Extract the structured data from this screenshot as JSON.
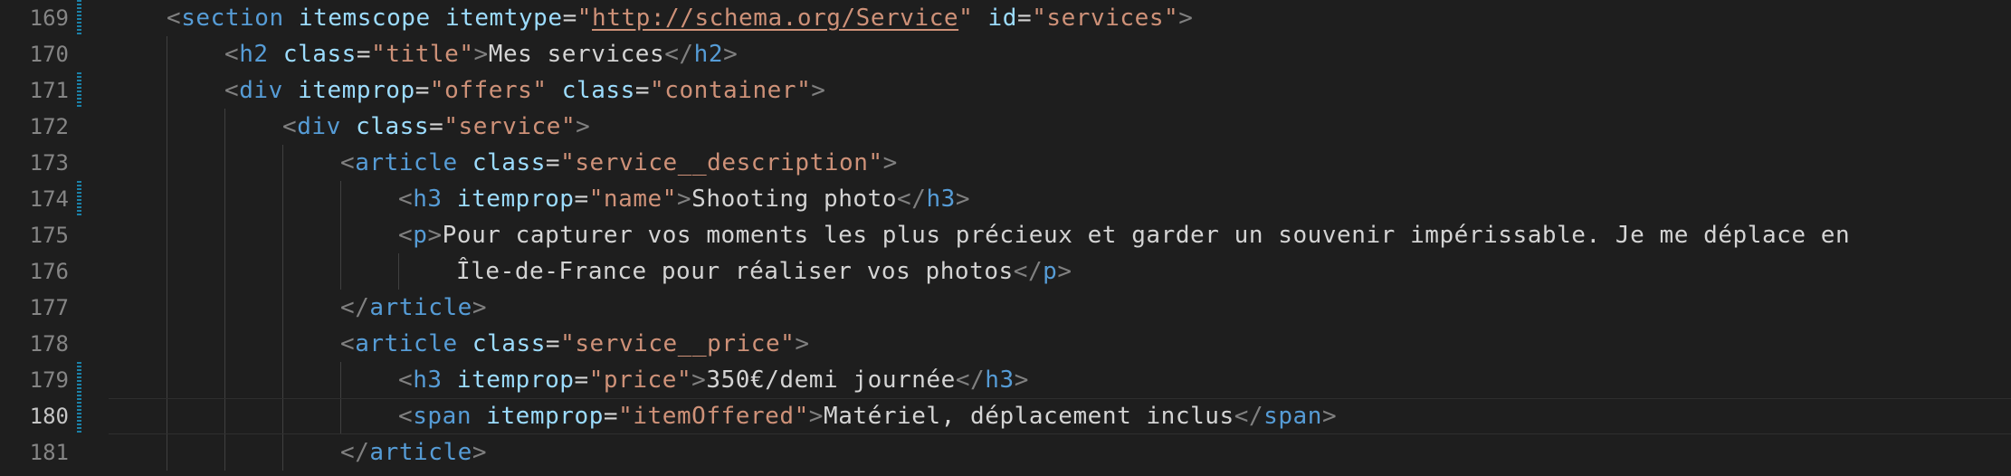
{
  "editor": {
    "current_line": "180",
    "lines": [
      {
        "num": "169",
        "tokens": [
          "<",
          "section",
          " ",
          "itemscope",
          " ",
          "itemtype",
          "=",
          "\"",
          "http://schema.org/Service",
          "\"",
          " ",
          "id",
          "=",
          "\"services\"",
          ">"
        ]
      },
      {
        "num": "170",
        "tokens": [
          "<",
          "h2",
          " ",
          "class",
          "=",
          "\"title\"",
          ">",
          "Mes services",
          "</",
          "h2",
          ">"
        ]
      },
      {
        "num": "171",
        "tokens": [
          "<",
          "div",
          " ",
          "itemprop",
          "=",
          "\"offers\"",
          " ",
          "class",
          "=",
          "\"container\"",
          ">"
        ]
      },
      {
        "num": "172",
        "tokens": [
          "<",
          "div",
          " ",
          "class",
          "=",
          "\"service\"",
          ">"
        ]
      },
      {
        "num": "173",
        "tokens": [
          "<",
          "article",
          " ",
          "class",
          "=",
          "\"service__description\"",
          ">"
        ]
      },
      {
        "num": "174",
        "tokens": [
          "<",
          "h3",
          " ",
          "itemprop",
          "=",
          "\"name\"",
          ">",
          "Shooting photo",
          "</",
          "h3",
          ">"
        ]
      },
      {
        "num": "175",
        "tokens": [
          "<",
          "p",
          ">",
          "Pour capturer vos moments les plus précieux et garder un souvenir impérissable. Je me déplace en"
        ]
      },
      {
        "num": "176",
        "tokens": [
          "Île-de-France pour réaliser vos photos",
          "</",
          "p",
          ">"
        ]
      },
      {
        "num": "177",
        "tokens": [
          "</",
          "article",
          ">"
        ]
      },
      {
        "num": "178",
        "tokens": [
          "<",
          "article",
          " ",
          "class",
          "=",
          "\"service__price\"",
          ">"
        ]
      },
      {
        "num": "179",
        "tokens": [
          "<",
          "h3",
          " ",
          "itemprop",
          "=",
          "\"price\"",
          ">",
          "350€/demi journée",
          "</",
          "h3",
          ">"
        ]
      },
      {
        "num": "180",
        "tokens": [
          "<",
          "span",
          " ",
          "itemprop",
          "=",
          "\"itemOffered\"",
          ">",
          "Matériel, déplacement inclus",
          "</",
          "span",
          ">"
        ]
      },
      {
        "num": "181",
        "tokens": [
          "</",
          "article",
          ">"
        ]
      }
    ]
  },
  "colors": {
    "background": "#1e1e1e",
    "punctuation": "#808080",
    "tag": "#569cd6",
    "attribute": "#9cdcfe",
    "string": "#ce9178",
    "text": "#d4d4d4",
    "line_number": "#858585",
    "git_modified": "#1b81a8"
  }
}
